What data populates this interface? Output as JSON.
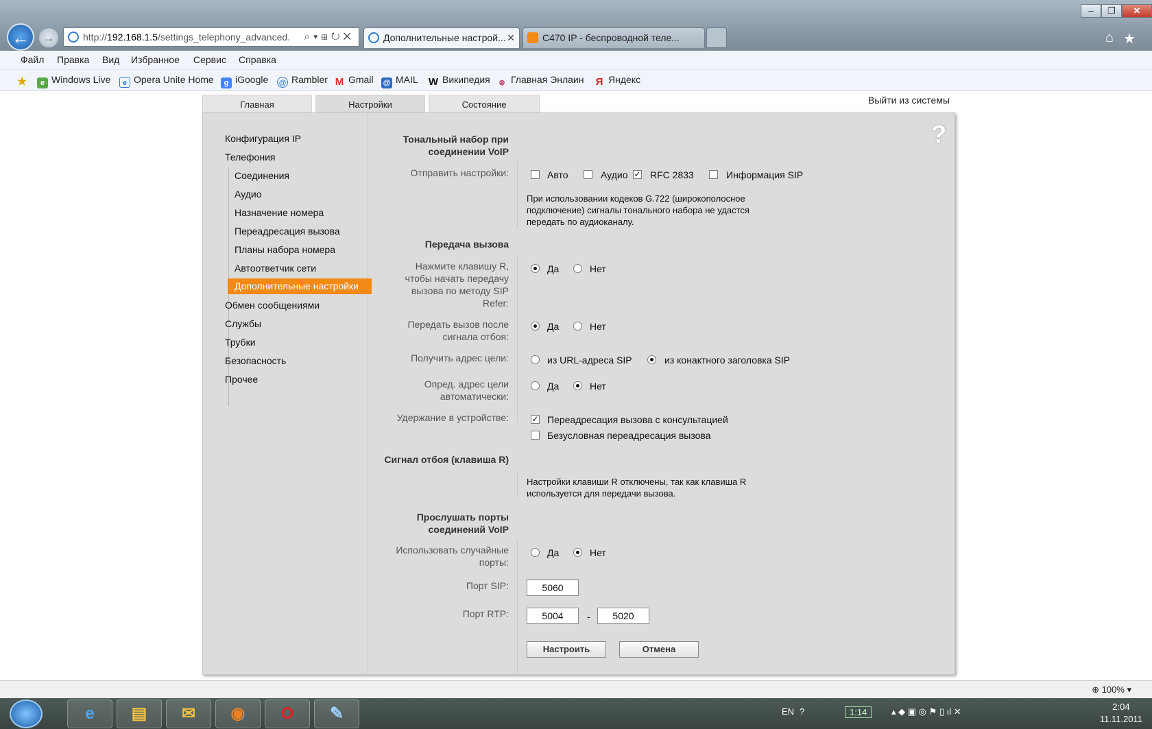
{
  "browser": {
    "address_prefix": "http://",
    "address_host": "192.168.1.5",
    "address_path": "/settings_telephony_advanced.",
    "tabs": [
      {
        "label": "Дополнительные настрой...",
        "active": true
      },
      {
        "label": "C470 IP - беспроводной теле...",
        "active": false
      }
    ],
    "menu": [
      "Файл",
      "Правка",
      "Вид",
      "Избранное",
      "Сервис",
      "Справка"
    ],
    "favorites": [
      "Windows Live",
      "Opera Unite Home",
      "iGoogle",
      "Rambler",
      "Gmail",
      "MAIL",
      "Википедия",
      "Главная Энлаин",
      "Яндекс"
    ],
    "zoom": "100%"
  },
  "page": {
    "tabs": [
      "Главная",
      "Настройки",
      "Состояние"
    ],
    "active_tab": "Настройки",
    "logout": "Выйти из системы",
    "help": "?",
    "sidebar": {
      "items": [
        "Конфигурация IP",
        "Телефония",
        "Обмен сообщениями",
        "Службы",
        "Трубки",
        "Безопасность",
        "Прочее"
      ],
      "telephony_sub": [
        "Соединения",
        "Аудио",
        "Назначение номера",
        "Переадресация вызова",
        "Планы набора номера",
        "Автоответчик сети",
        "Дополнительные настройки"
      ]
    },
    "dtmf": {
      "title_line1": "Тональный набор при",
      "title_line2": "соединении VoIP",
      "send_label": "Отправить настройки:",
      "opt_auto": "Авто",
      "opt_audio": "Аудио",
      "opt_rfc": "RFC 2833",
      "opt_sip": "Информация SIP",
      "checked": {
        "auto": false,
        "audio": false,
        "rfc": true,
        "sip": false
      },
      "note_line1": "При использовании кодеков G.722 (широкополосное",
      "note_line2": "подключение) сигналы тонального набора не удастся",
      "note_line3": "передать по аудиоканалу."
    },
    "transfer": {
      "title": "Передача вызова",
      "r_label_1": "Нажмите клавишу R,",
      "r_label_2": "чтобы начать передачу",
      "r_label_3": "вызова по методу SIP",
      "r_label_4": "Refer:",
      "hook_label_1": "Передать вызов после",
      "hook_label_2": "сигнала отбоя:",
      "target_label": "Получить адрес цели:",
      "target_opt1": "из URL-адреса SIP",
      "target_opt2": "из конактного заголовка SIP",
      "auto_label_1": "Опред. адрес цели",
      "auto_label_2": "автоматически:",
      "hold_label": "Удержание в устройстве:",
      "hold_opt1": "Переадресация вызова с консультацией",
      "hold_opt2": "Безусловная переадресация вызова",
      "yes": "Да",
      "no": "Нет"
    },
    "flash": {
      "title": "Сигнал отбоя (клавиша R)",
      "note_line1": "Настройки клавиши R отключены, так как клавиша R",
      "note_line2": "используется для передачи вызова."
    },
    "ports": {
      "title_line1": "Прослушать порты",
      "title_line2": "соединений VoIP",
      "random_label_1": "Использовать случайные",
      "random_label_2": "порты:",
      "sip_label": "Порт SIP:",
      "sip_value": "5060",
      "rtp_label": "Порт RTP:",
      "rtp_from": "5004",
      "rtp_sep": "-",
      "rtp_to": "5020"
    },
    "buttons": {
      "apply": "Настроить",
      "cancel": "Отмена"
    }
  },
  "taskbar": {
    "lang": "EN",
    "battery": "1:14",
    "time": "2:04",
    "date": "11.11.2011"
  }
}
